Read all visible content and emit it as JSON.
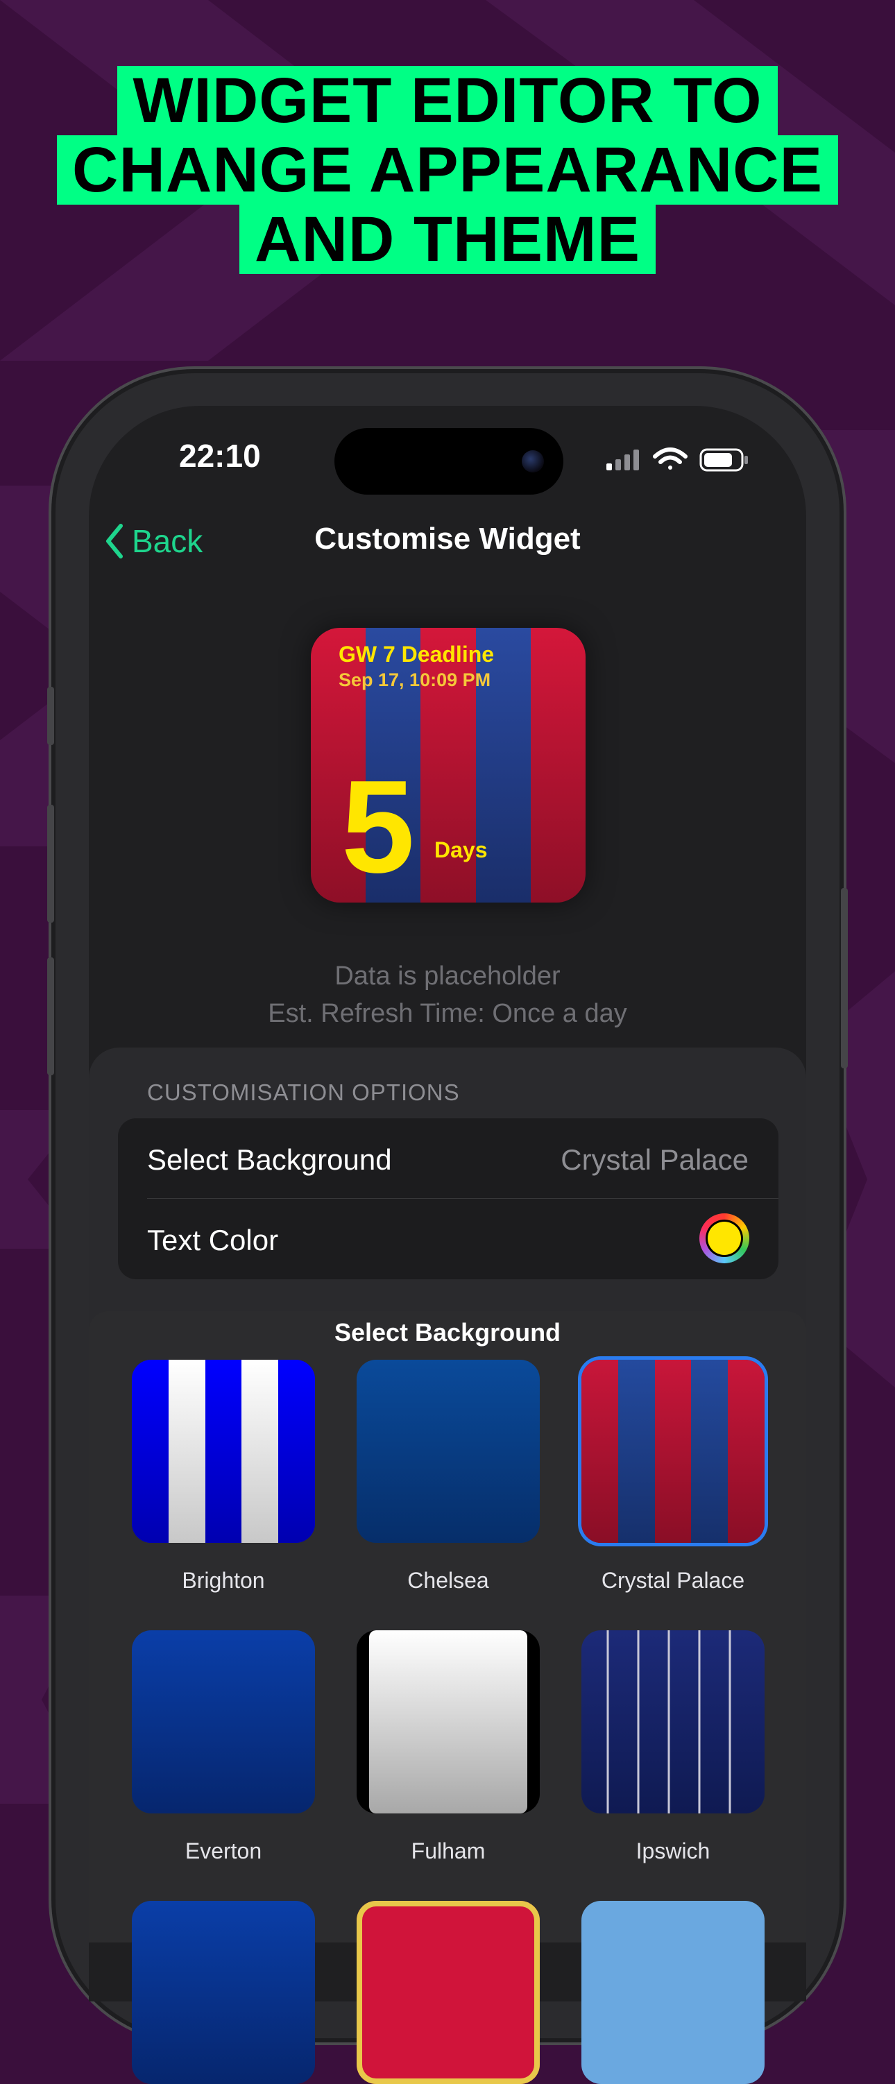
{
  "headline": {
    "lines": [
      "WIDGET EDITOR TO",
      "CHANGE APPEARANCE",
      "AND THEME"
    ]
  },
  "status_bar": {
    "time": "22:10"
  },
  "navbar": {
    "back_label": "Back",
    "title": "Customise Widget"
  },
  "widget_preview": {
    "title": "GW 7 Deadline",
    "date": "Sep 17, 10:09 PM",
    "count": "5",
    "unit": "Days"
  },
  "notes": {
    "placeholder": "Data is placeholder",
    "refresh": "Est. Refresh Time: Once a day"
  },
  "options": {
    "header": "CUSTOMISATION OPTIONS",
    "background_label": "Select Background",
    "background_value": "Crystal Palace",
    "text_color_label": "Text Color",
    "text_color": "#ffe600"
  },
  "picker": {
    "title": "Select Background",
    "selected": "Crystal Palace",
    "items": [
      {
        "label": "Brighton"
      },
      {
        "label": "Chelsea"
      },
      {
        "label": "Crystal Palace"
      },
      {
        "label": "Everton"
      },
      {
        "label": "Fulham"
      },
      {
        "label": "Ipswich"
      }
    ]
  },
  "colors": {
    "accent": "#1ed58d",
    "headline_bg": "#00ff85",
    "selection": "#2a7cf0"
  }
}
